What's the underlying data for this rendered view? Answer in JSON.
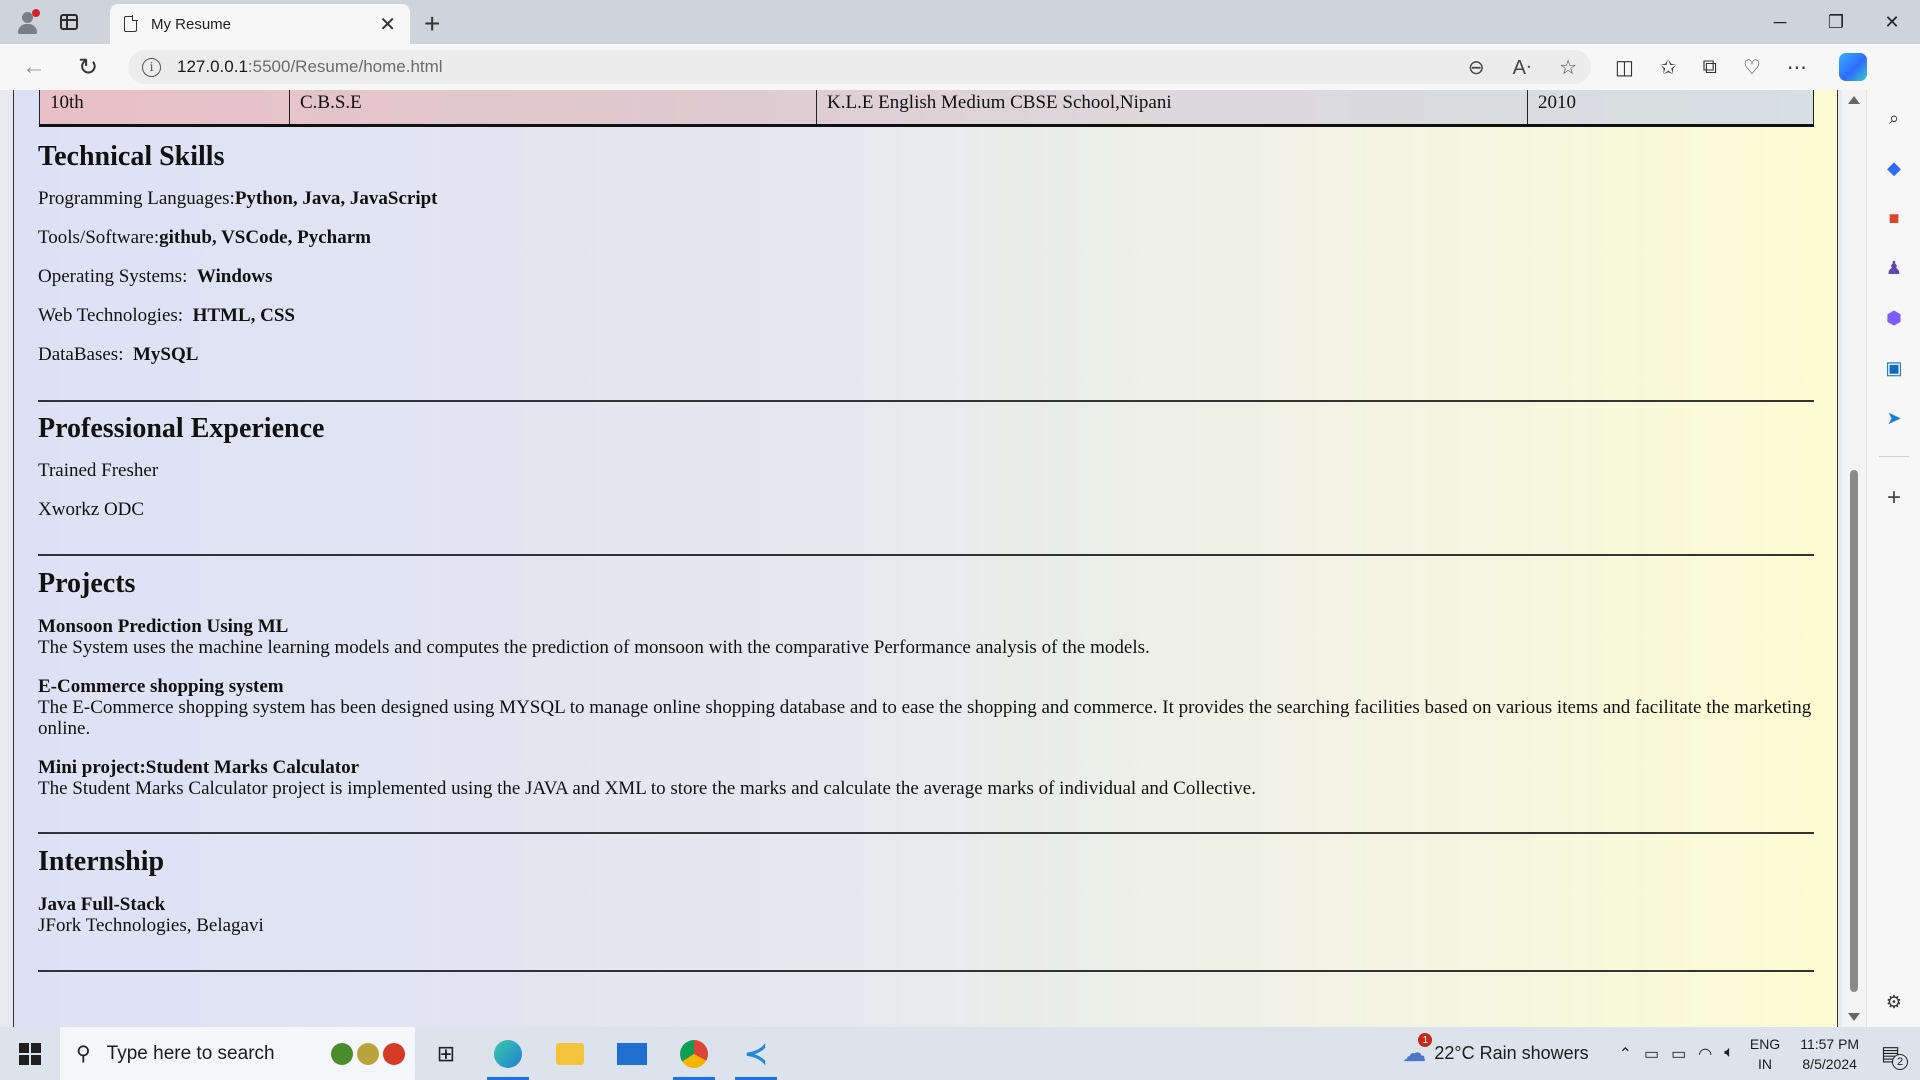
{
  "browser": {
    "tab_title": "My Resume",
    "url_host": "127.0.0.1",
    "url_path": ":5500/Resume/home.html",
    "info_glyph": "i"
  },
  "education_row": {
    "level": "10th",
    "board": "C.B.S.E",
    "school": "K.L.E English Medium CBSE School,Nipani",
    "year": "2010"
  },
  "technical_skills": {
    "heading": "Technical Skills",
    "items": [
      {
        "label": "Programming Languages:",
        "value": "Python, Java, JavaScript"
      },
      {
        "label": "Tools/Software:",
        "value": "github, VSCode, Pycharm"
      },
      {
        "label": "Operating Systems: ",
        "value": "Windows"
      },
      {
        "label": "Web Technologies: ",
        "value": "HTML, CSS"
      },
      {
        "label": "DataBases: ",
        "value": "MySQL"
      }
    ]
  },
  "experience": {
    "heading": "Professional Experience",
    "items": [
      "Trained Fresher",
      "Xworkz ODC"
    ]
  },
  "projects": {
    "heading": "Projects",
    "items": [
      {
        "title": "Monsoon Prediction Using ML",
        "description": "The System uses the machine learning models and computes the prediction of monsoon with the comparative Performance analysis of the models."
      },
      {
        "title": "E-Commerce shopping system",
        "description": "The E-Commerce shopping system has been designed using MYSQL to manage online shopping database and to ease the shopping and commerce. It provides the searching facilities based on various items and facilitate the marketing online."
      },
      {
        "title": "Mini project:Student Marks Calculator",
        "description": "The Student Marks Calculator project is implemented using the JAVA and XML to store the marks and calculate the average marks of individual and Collective."
      }
    ]
  },
  "internship": {
    "heading": "Internship",
    "title": "Java Full-Stack",
    "company": "JFork Technologies, Belagavi"
  },
  "taskbar": {
    "search_placeholder": "Type here to search",
    "weather": "22°C  Rain showers",
    "weather_badge": "1",
    "lang_1": "ENG",
    "lang_2": "IN",
    "time": "11:57 PM",
    "date": "8/5/2024",
    "notification_count": "2"
  },
  "colors": {
    "table_left": "#e9c0c7",
    "page_left": "#dde1f5",
    "page_right": "#fcfcd2",
    "accent": "#1a73e8"
  }
}
